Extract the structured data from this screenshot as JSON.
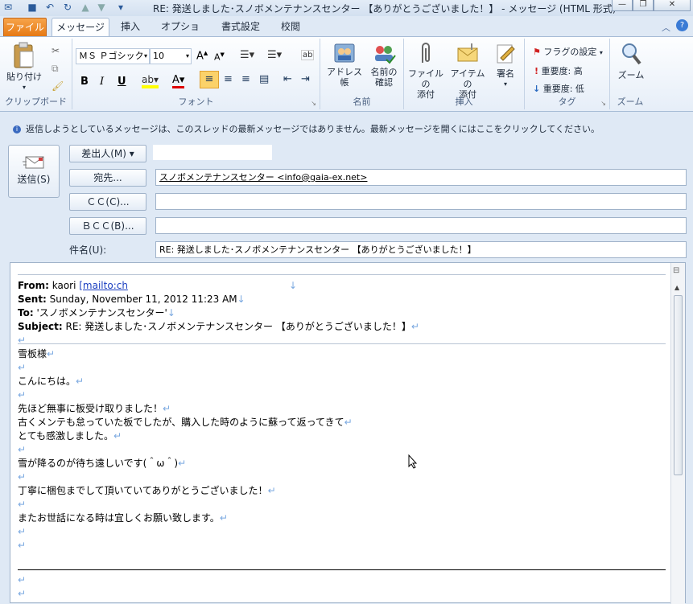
{
  "window": {
    "title": "RE: 発送しました･スノボメンテナンスセンター  【ありがとうございました！】 - メッセージ (HTML 形式)",
    "min": "—",
    "max": "❐",
    "close": "✕"
  },
  "tabs": {
    "file": "ファイル",
    "message": "メッセージ",
    "insert": "挿入",
    "options": "オプション",
    "format": "書式設定",
    "review": "校閲"
  },
  "ribbon": {
    "clipboard": {
      "paste": "貼り付け",
      "group": "クリップボード"
    },
    "font": {
      "name": "ＭＳ Ｐゴシック",
      "size": "10",
      "bold": "B",
      "italic": "I",
      "underline": "U",
      "group": "フォント"
    },
    "names": {
      "address_book": "アドレス帳",
      "check_names_1": "名前の",
      "check_names_2": "確認",
      "group": "名前"
    },
    "include": {
      "attach_file_1": "ファイルの",
      "attach_file_2": "添付",
      "attach_item_1": "アイテムの",
      "attach_item_2": "添付",
      "signature": "署名",
      "group": "挿入"
    },
    "tags": {
      "flag": "フラグの設定",
      "high": "重要度: 高",
      "low": "重要度: 低",
      "group": "タグ"
    },
    "zoom": {
      "zoom": "ズーム",
      "group": "ズーム"
    }
  },
  "infobar": "返信しようとしているメッセージは、このスレッドの最新メッセージではありません。最新メッセージを開くにはここをクリックしてください。",
  "header": {
    "send": "送信(S)",
    "from_btn": "差出人(M) ▾",
    "to_btn": "宛先...",
    "cc_btn": "ＣＣ(C)...",
    "bcc_btn": "ＢＣＣ(B)...",
    "subject_label": "件名(U):",
    "to_value": "スノボメンテナンスセンター <info@gaia-ex.net>",
    "cc_value": "",
    "bcc_value": "",
    "subject_value": "RE: 発送しました･スノボメンテナンスセンター  【ありがとうございました！】"
  },
  "body": {
    "from_label": "From:",
    "from_name": " kaori ",
    "from_link": "[mailto:ch",
    "sent_label": "Sent:",
    "sent_value": " Sunday, November 11, 2012 11:23 AM",
    "to_label": "To:",
    "to_value": " 'スノボメンテナンスセンター'",
    "subject_label": "Subject:",
    "subject_value": " RE: 発送しました･スノボメンテナンスセンター  【ありがとうございました！】",
    "lines": [
      "雪板様",
      "",
      "こんにちは。",
      "",
      "先ほど無事に板受け取りました！",
      "古くメンテも怠っていた板でしたが、購入した時のように蘇って返ってきて",
      "とても感激しました。",
      "",
      "雪が降るのが待ち遠しいです(＾ω＾)",
      "",
      "丁寧に梱包までして頂いていてありがとうございました！",
      "",
      "またお世話になる時は宜しくお願い致します。",
      "",
      "",
      "",
      ""
    ]
  }
}
